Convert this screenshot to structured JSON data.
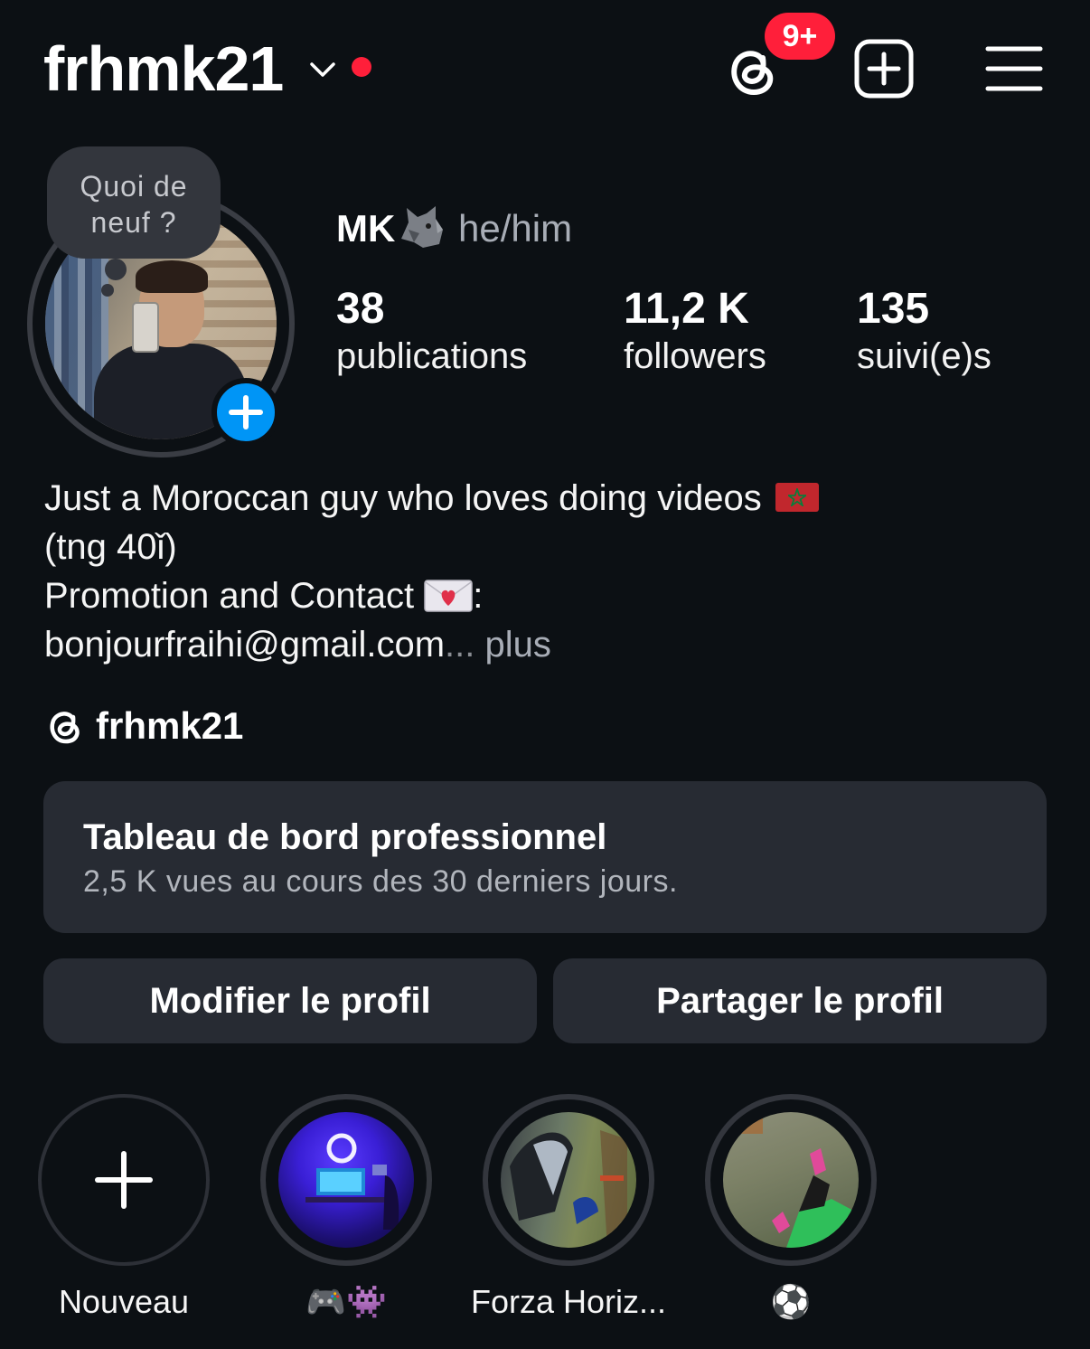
{
  "header": {
    "username": "frhmk21",
    "notification_badge": "9+",
    "colors": {
      "badge": "#ff1f3a",
      "live_dot": "#ff1f3a"
    }
  },
  "profile": {
    "note": "Quoi de neuf ?",
    "display_name": "MK",
    "display_name_emoji": "wolf-icon",
    "pronouns": "he/him",
    "stats": [
      {
        "value": "38",
        "label": "publications"
      },
      {
        "value": "11,2 K",
        "label": "followers"
      },
      {
        "value": "135",
        "label": "suivi(e)s"
      }
    ]
  },
  "bio": {
    "line1": "Just a Moroccan guy who loves doing videos",
    "line1_emoji": "morocco-flag-icon",
    "line2": "(tng 40ǐ)",
    "line3": "Promotion and Contact",
    "line3_emoji": "love-letter-icon",
    "line3_suffix": ":",
    "line4": "bonjourfraihi@gmail.com",
    "ellipsis": "...",
    "more_label": "plus"
  },
  "threads_link": {
    "handle": "frhmk21"
  },
  "dashboard": {
    "title": "Tableau de bord professionnel",
    "subtitle": "2,5 K vues au cours des 30 derniers jours."
  },
  "actions": {
    "edit_label": "Modifier le profil",
    "share_label": "Partager le profil"
  },
  "highlights": [
    {
      "label": "Nouveau",
      "kind": "new"
    },
    {
      "label": "🎮👾",
      "kind": "image"
    },
    {
      "label": "Forza Horiz...",
      "kind": "image"
    },
    {
      "label": "⚽",
      "kind": "image"
    }
  ],
  "colors": {
    "background": "#0c1014",
    "card": "#272b33",
    "accent_blue": "#0095f6"
  }
}
